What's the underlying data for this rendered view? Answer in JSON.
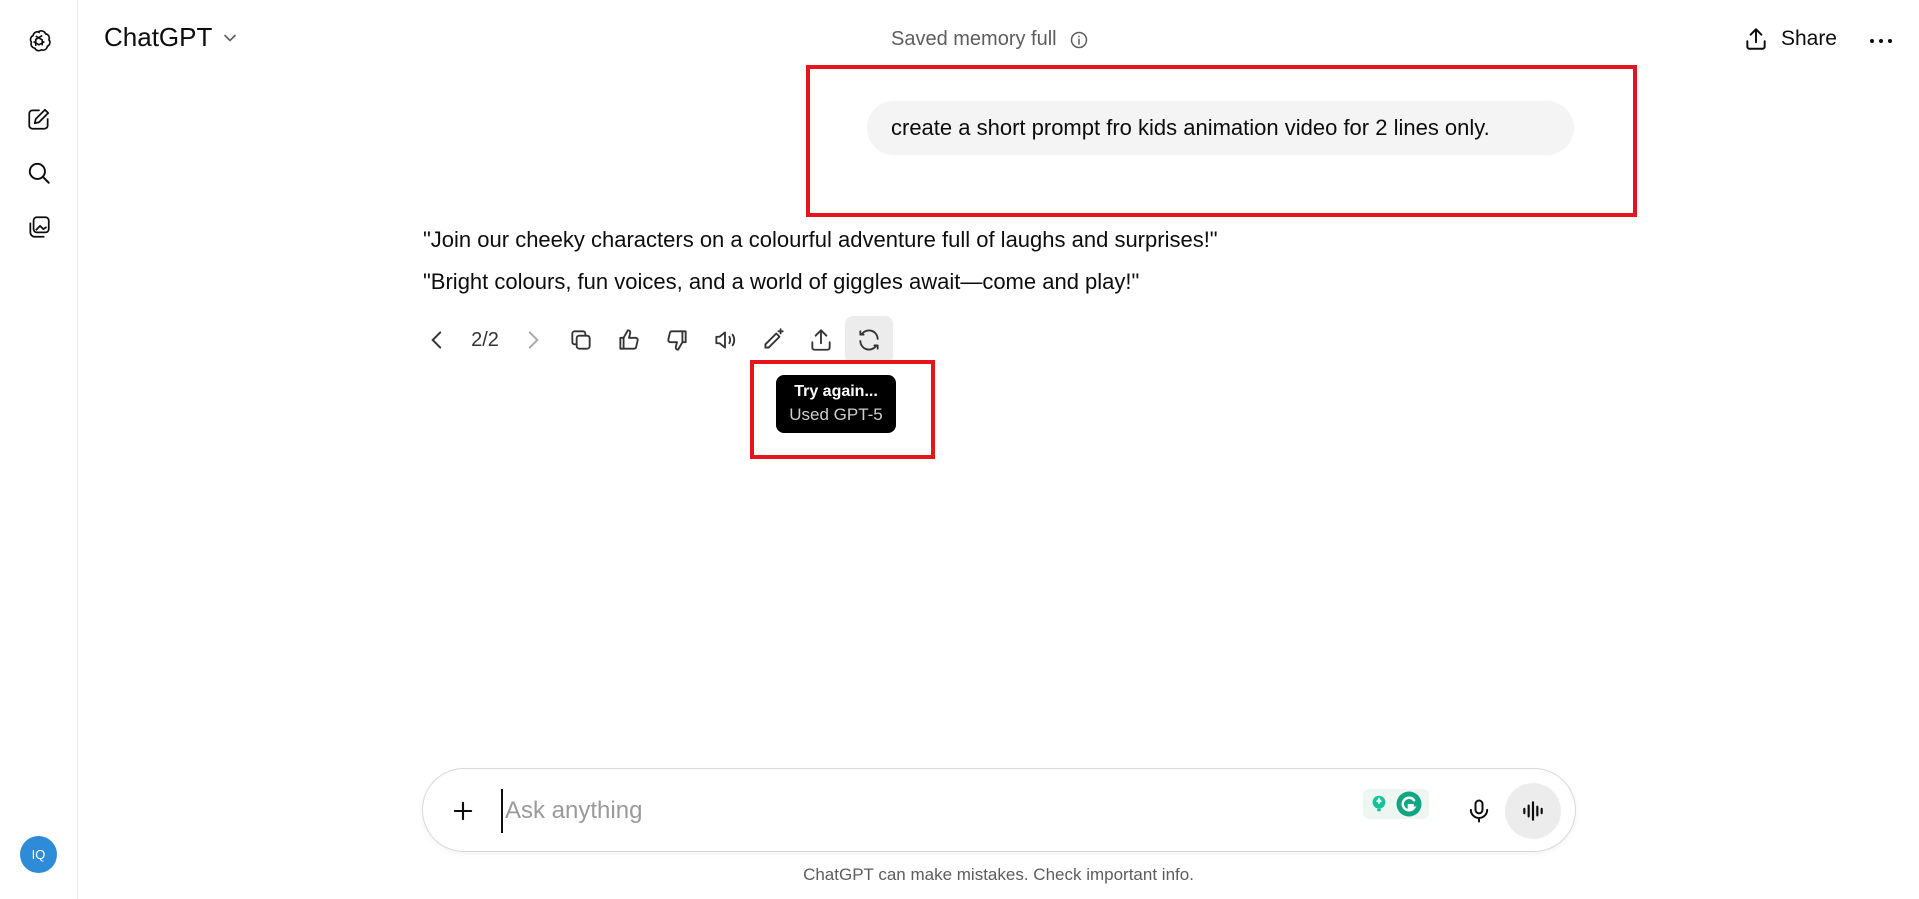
{
  "sidebar": {
    "avatar_initials": "IQ",
    "avatar_color": "#2e8bd8"
  },
  "header": {
    "model_name": "ChatGPT",
    "memory_status": "Saved memory full",
    "share_label": "Share"
  },
  "conversation": {
    "user_message": "create a short prompt fro kids animation video for 2 lines only.",
    "assistant_lines": [
      "\"Join our cheeky characters on a colourful adventure full of laughs and surprises!\"",
      "\"Bright colours, fun voices, and a world of giggles await—come and play!\""
    ],
    "response_pager": "2/2"
  },
  "tooltip": {
    "title": "Try again...",
    "subtitle": "Used GPT-5"
  },
  "composer": {
    "placeholder": "Ask anything",
    "value": ""
  },
  "footer": {
    "disclaimer": "ChatGPT can make mistakes. Check important info."
  },
  "colors": {
    "highlight_box": "#e8141b",
    "user_bubble": "#f4f4f4",
    "tooltip_bg": "#000000"
  },
  "icons": [
    "openai-logo-icon",
    "new-chat-icon",
    "search-icon",
    "library-icon",
    "chevron-down-icon",
    "info-icon",
    "share-icon",
    "more-icon",
    "chevron-left-icon",
    "chevron-right-icon",
    "copy-icon",
    "thumbs-up-icon",
    "thumbs-down-icon",
    "read-aloud-icon",
    "edit-icon",
    "export-icon",
    "regenerate-icon",
    "plus-icon",
    "grammarly-icon",
    "mic-icon",
    "voice-mode-icon"
  ]
}
